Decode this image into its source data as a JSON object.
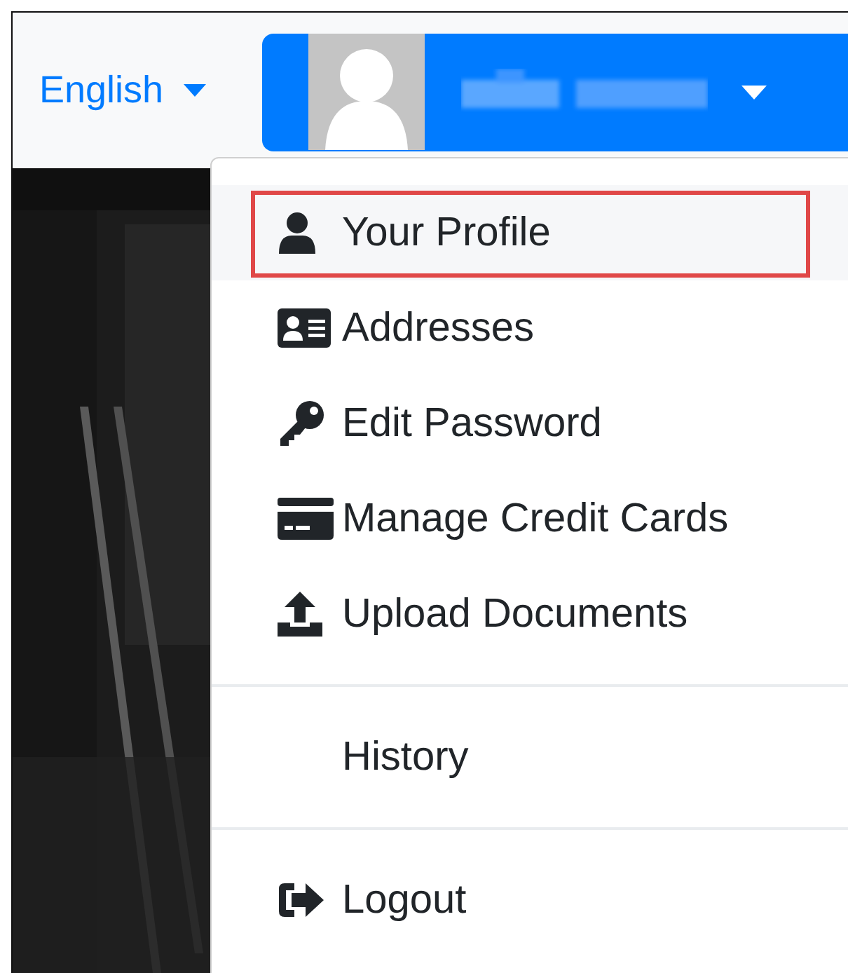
{
  "navbar": {
    "language": {
      "label": "English"
    },
    "user_menu": {
      "expanded": true
    }
  },
  "dropdown": {
    "sections": [
      [
        {
          "label": "Your Profile",
          "selected": true
        },
        {
          "label": "Addresses",
          "selected": false
        },
        {
          "label": "Edit Password",
          "selected": false
        },
        {
          "label": "Manage Credit Cards",
          "selected": false
        },
        {
          "label": "Upload Documents",
          "selected": false
        }
      ],
      [
        {
          "label": "History",
          "selected": false
        }
      ],
      [
        {
          "label": "Logout",
          "selected": false
        }
      ]
    ]
  }
}
